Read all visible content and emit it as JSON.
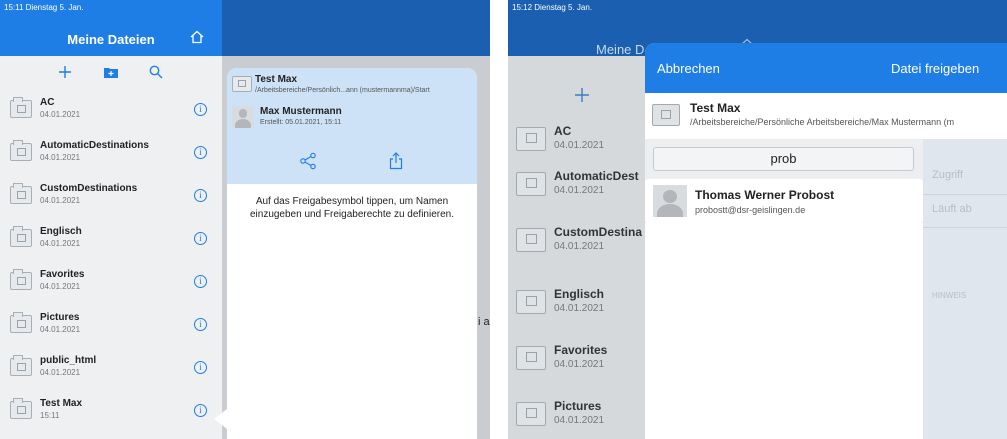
{
  "left": {
    "status_bar": "15:11  Dienstag 5. Jan.",
    "header": {
      "title": "Meine Dateien"
    },
    "items": [
      {
        "name": "AC",
        "date": "04.01.2021"
      },
      {
        "name": "AutomaticDestinations",
        "date": "04.01.2021"
      },
      {
        "name": "CustomDestinations",
        "date": "04.01.2021"
      },
      {
        "name": "Englisch",
        "date": "04.01.2021"
      },
      {
        "name": "Favorites",
        "date": "04.01.2021"
      },
      {
        "name": "Pictures",
        "date": "04.01.2021"
      },
      {
        "name": "public_html",
        "date": "04.01.2021"
      },
      {
        "name": "Test Max",
        "date": "15:11"
      }
    ],
    "background_fragment": "i a",
    "popover": {
      "file_name": "Test Max",
      "file_path": "/Arbeitsbereiche/Persönlich...ann (mustermannma)/Start",
      "user_name": "Max Mustermann",
      "created": "Erstellt: 05.01.2021, 15:11",
      "hint": "Auf das Freigabesymbol tippen, um Namen einzugeben und Freigaberechte zu definieren."
    }
  },
  "right": {
    "status_bar": "15:12  Dienstag 5. Jan.",
    "header": {
      "title": "Meine D"
    },
    "items": [
      {
        "name": "AC",
        "date": "04.01.2021"
      },
      {
        "name": "AutomaticDest",
        "date": "04.01.2021"
      },
      {
        "name": "CustomDestina",
        "date": "04.01.2021"
      },
      {
        "name": "Englisch",
        "date": "04.01.2021"
      },
      {
        "name": "Favorites",
        "date": "04.01.2021"
      },
      {
        "name": "Pictures",
        "date": "04.01.2021"
      }
    ],
    "modal": {
      "cancel_label": "Abbrechen",
      "share_label": "Datei freigeben",
      "file_name": "Test Max",
      "file_path": "/Arbeitsbereiche/Persönliche Arbeitsbereiche/Max Mustermann (m",
      "search_value": "prob",
      "result_name": "Thomas Werner Probost",
      "result_email": "probostt@dsr-geislingen.de",
      "access_label": "Zugriff",
      "expires_label": "Läuft ab",
      "note_label": "HINWEIS"
    }
  },
  "colors": {
    "primary": "#1f7ee6",
    "header_dark": "#1a5fb0",
    "selection": "#cde2f7"
  }
}
